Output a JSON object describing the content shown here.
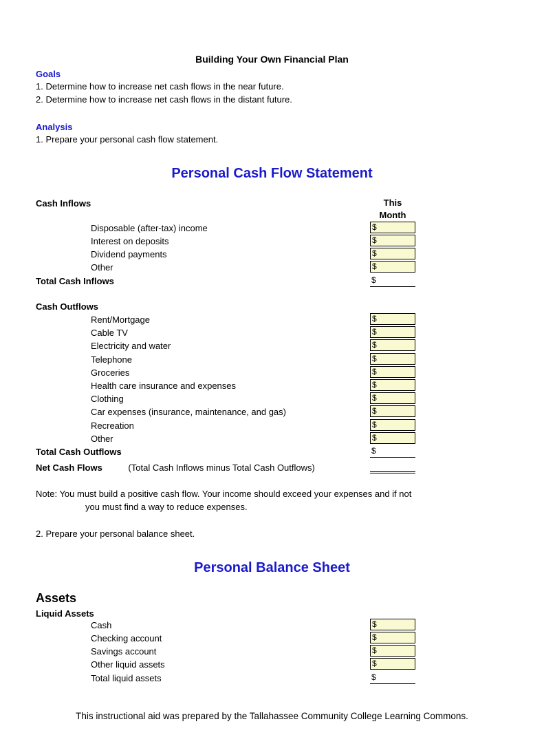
{
  "docTitle": "Building Your Own Financial Plan",
  "goalsHeading": "Goals",
  "goals": [
    "1. Determine how to increase net cash flows in the near future.",
    "2. Determine how to increase net cash flows in the distant future."
  ],
  "analysisHeading": "Analysis",
  "analysisItem": "1. Prepare your personal cash flow statement.",
  "cashFlowTitle": "Personal Cash Flow Statement",
  "columnHeader": "This Month",
  "currency": "$",
  "inflowsHeading": "Cash Inflows",
  "inflows": [
    "Disposable (after-tax) income",
    "Interest on deposits",
    "Dividend payments",
    "Other"
  ],
  "totalInflows": "Total Cash Inflows",
  "outflowsHeading": "Cash Outflows",
  "outflows": [
    "Rent/Mortgage",
    "Cable TV",
    "Electricity and water",
    "Telephone",
    "Groceries",
    "Health care insurance and expenses",
    "Clothing",
    "Car expenses (insurance, maintenance, and gas)",
    "Recreation",
    "Other"
  ],
  "totalOutflows": "Total Cash Outflows",
  "netCashLabel": "Net Cash Flows",
  "netCashExplain": "(Total Cash Inflows minus Total Cash Outflows)",
  "noteLine1": "Note: You must build a positive cash flow.  Your income should exceed your expenses and if not",
  "noteLine2": "you must find a way to reduce expenses.",
  "step2": "2. Prepare your personal balance sheet.",
  "balanceTitle": "Personal Balance Sheet",
  "assetsHeading": "Assets",
  "liquidHeading": "Liquid Assets",
  "liquidAssets": [
    "Cash",
    "Checking account",
    "Savings account",
    "Other liquid assets"
  ],
  "totalLiquid": "Total liquid assets",
  "footer": "This instructional aid was prepared by the Tallahassee Community College Learning Commons."
}
